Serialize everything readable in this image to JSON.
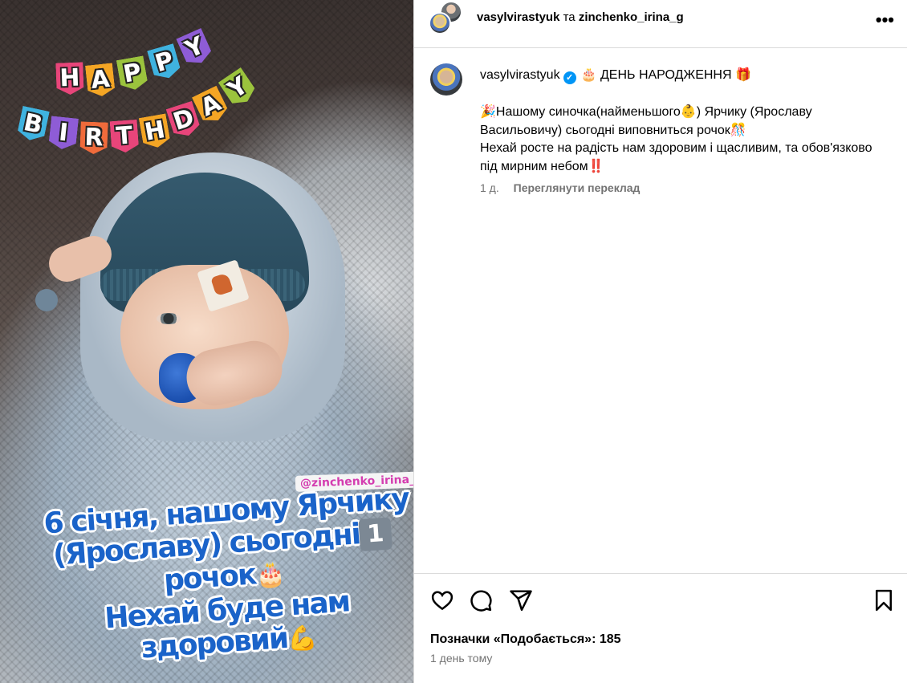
{
  "photo": {
    "bunting_top": [
      "H",
      "A",
      "P",
      "P",
      "Y"
    ],
    "bunting_bottom": [
      "B",
      "I",
      "R",
      "T",
      "H",
      "D",
      "A",
      "Y"
    ],
    "bunting_colors": [
      "#e8457a",
      "#f4a524",
      "#9bc33d",
      "#3fb3e0",
      "#8e5cd6",
      "#f06b3b",
      "#e8457a",
      "#f4a524"
    ],
    "mention": "@zinchenko_irina_g",
    "story_lines": [
      "6 січня, нашому Ярчику",
      "(Ярославу) сьогодні",
      "рочок",
      "Нехай буде нам",
      "здоровий"
    ],
    "one_badge": "1",
    "cake_emoji": "🎂",
    "muscle_emoji": "💪"
  },
  "header": {
    "user1": "vasylvirastyuk",
    "and": "та",
    "user2": "zinchenko_irina_g",
    "more_icon": "•••"
  },
  "caption": {
    "username": "vasylvirastyuk",
    "verified_mark": "✓",
    "title": "🎂 ДЕНЬ НАРОДЖЕННЯ 🎁",
    "body": "🎉Нашому синочка(найменьшого👶) Ярчику (Ярославу Васильовичу) сьогодні виповниться рочок🎊\nНехай росте на радість нам здоровим і щасливим, та обов'язково під мирним небом‼️",
    "age": "1 д.",
    "translate": "Переглянути переклад"
  },
  "footer": {
    "likes": "Позначки «Подобається»: 185",
    "time": "1 день тому"
  }
}
